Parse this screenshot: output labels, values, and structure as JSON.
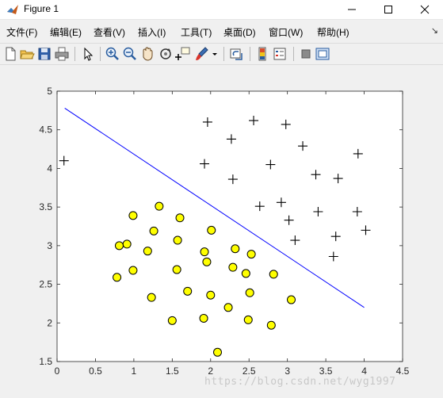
{
  "window": {
    "title": "Figure 1",
    "icon": "matlab-icon",
    "controls": [
      "minimize-icon",
      "maximize-icon",
      "close-icon"
    ]
  },
  "menu": {
    "items": [
      "文件(F)",
      "编辑(E)",
      "查看(V)",
      "插入(I)",
      "工具(T)",
      "桌面(D)",
      "窗口(W)",
      "帮助(H)"
    ],
    "overflow": "↘"
  },
  "toolbar": {
    "icons": [
      "new-figure-icon",
      "open-file-icon",
      "save-icon",
      "print-icon",
      "edit-plot-pointer-icon",
      "zoom-in-icon",
      "zoom-out-icon",
      "pan-hand-icon",
      "rotate-3d-icon",
      "data-cursor-icon",
      "brush-icon",
      "brush-dropdown-icon",
      "link-plot-icon",
      "insert-colorbar-icon",
      "insert-legend-icon",
      "hide-plot-tools-icon",
      "show-plot-tools-icon"
    ]
  },
  "watermark": "https://blog.csdn.net/wyg1997",
  "chart_data": {
    "type": "scatter",
    "title": "",
    "xlabel": "",
    "ylabel": "",
    "xlim": [
      0,
      4.5
    ],
    "ylim": [
      1.5,
      5
    ],
    "xticks": [
      "0",
      "0.5",
      "1",
      "1.5",
      "2",
      "2.5",
      "3",
      "3.5",
      "4",
      "4.5"
    ],
    "yticks": [
      "1.5",
      "2",
      "2.5",
      "3",
      "3.5",
      "4",
      "4.5",
      "5"
    ],
    "grid": false,
    "legend": "none",
    "series": [
      {
        "marker": "plus",
        "color": "#000000",
        "points": [
          [
            0.09,
            4.1
          ],
          [
            1.96,
            4.6
          ],
          [
            2.56,
            4.62
          ],
          [
            2.98,
            4.57
          ],
          [
            2.27,
            4.38
          ],
          [
            3.2,
            4.29
          ],
          [
            3.92,
            4.19
          ],
          [
            1.92,
            4.06
          ],
          [
            2.78,
            4.05
          ],
          [
            3.37,
            3.92
          ],
          [
            2.29,
            3.86
          ],
          [
            3.66,
            3.87
          ],
          [
            2.64,
            3.51
          ],
          [
            2.92,
            3.56
          ],
          [
            3.02,
            3.33
          ],
          [
            3.4,
            3.44
          ],
          [
            3.91,
            3.44
          ],
          [
            4.02,
            3.2
          ],
          [
            3.1,
            3.07
          ],
          [
            3.63,
            3.12
          ],
          [
            3.6,
            2.86
          ]
        ]
      },
      {
        "marker": "circle",
        "color": "#ffff00",
        "edgecolor": "#000000",
        "points": [
          [
            1.33,
            3.51
          ],
          [
            0.99,
            3.39
          ],
          [
            1.6,
            3.36
          ],
          [
            1.26,
            3.19
          ],
          [
            2.01,
            3.2
          ],
          [
            0.91,
            3.02
          ],
          [
            0.81,
            3.0
          ],
          [
            1.57,
            3.07
          ],
          [
            1.18,
            2.93
          ],
          [
            1.92,
            2.92
          ],
          [
            2.32,
            2.96
          ],
          [
            2.53,
            2.89
          ],
          [
            1.95,
            2.79
          ],
          [
            0.99,
            2.68
          ],
          [
            1.56,
            2.69
          ],
          [
            2.29,
            2.72
          ],
          [
            2.46,
            2.64
          ],
          [
            2.82,
            2.63
          ],
          [
            0.78,
            2.59
          ],
          [
            1.7,
            2.41
          ],
          [
            2.51,
            2.39
          ],
          [
            1.23,
            2.33
          ],
          [
            2.0,
            2.36
          ],
          [
            3.05,
            2.3
          ],
          [
            2.23,
            2.2
          ],
          [
            1.91,
            2.06
          ],
          [
            1.5,
            2.03
          ],
          [
            2.49,
            2.04
          ],
          [
            2.79,
            1.97
          ],
          [
            2.09,
            1.62
          ]
        ]
      },
      {
        "marker": "line",
        "color": "#0000ff",
        "points": [
          [
            0.1,
            4.78
          ],
          [
            4.0,
            2.2
          ]
        ]
      }
    ]
  }
}
